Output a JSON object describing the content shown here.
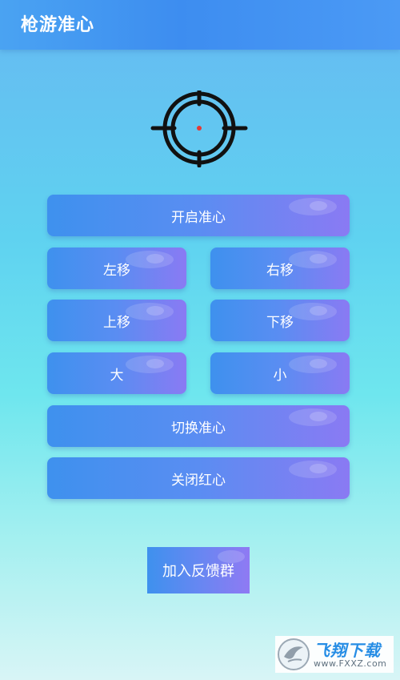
{
  "header": {
    "title": "枪游准心"
  },
  "crosshair": {
    "icon": "crosshair-icon",
    "center_dot_color": "#e53935"
  },
  "buttons": {
    "open": "开启准心",
    "left": "左移",
    "right": "右移",
    "up": "上移",
    "down": "下移",
    "bigger": "大",
    "smaller": "小",
    "switch": "切换准心",
    "close_red": "关闭红心"
  },
  "feedback": {
    "label": "加入反馈群"
  },
  "watermark": {
    "brand": "飞翔下载",
    "url": "www.FXXZ.com"
  },
  "colors": {
    "header": "#3d8df0",
    "button_start": "#3e91ee",
    "button_end": "#8a7af3"
  }
}
